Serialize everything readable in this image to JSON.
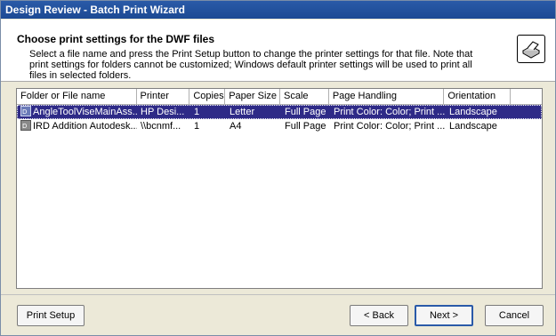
{
  "window": {
    "title": "Design Review - Batch Print Wizard"
  },
  "header": {
    "title": "Choose print settings for the DWF files",
    "description": "Select a file name and press the Print Setup button to change the printer settings for that file. Note that print settings for folders cannot be customized; Windows default printer settings will be used to print all files in selected folders.",
    "icon": "printer-icon"
  },
  "list": {
    "columns": [
      "Folder or File name",
      "Printer",
      "Copies",
      "Paper Size",
      "Scale",
      "Page Handling",
      "Orientation"
    ],
    "rows": [
      {
        "name": "AngleToolViseMainAss...",
        "printer": "HP Desi...",
        "copies": "1",
        "paper": "Letter",
        "scale": "Full Page",
        "handling": "Print Color: Color; Print ...",
        "orientation": "Landscape",
        "selected": true,
        "icon": "dwf-file-icon"
      },
      {
        "name": "IRD Addition Autodesk...",
        "printer": "\\\\bcnmf...",
        "copies": "1",
        "paper": "A4",
        "scale": "Full Page",
        "handling": "Print Color: Color; Print ...",
        "orientation": "Landscape",
        "selected": false,
        "icon": "dwf-file-icon"
      }
    ]
  },
  "buttons": {
    "print_setup": "Print Setup",
    "back": "< Back",
    "next": "Next >",
    "cancel": "Cancel"
  },
  "colors": {
    "title_bar": "#1c4a94",
    "selection": "#2e2a87"
  }
}
